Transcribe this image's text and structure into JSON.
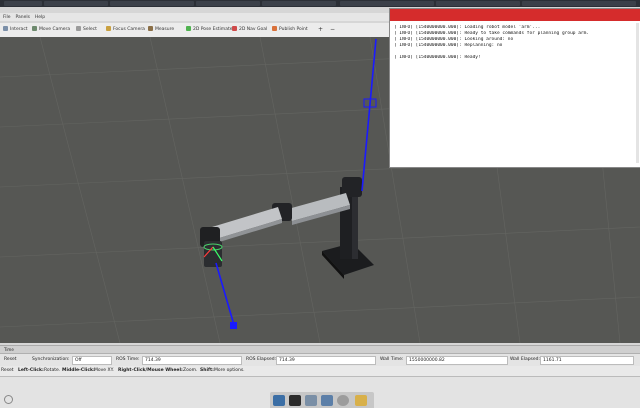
{
  "menubar": {
    "items": [
      "File",
      "Panels",
      "Help"
    ]
  },
  "toolbar": {
    "tools": [
      {
        "label": "Interact",
        "icon": "hand-icon"
      },
      {
        "label": "Move Camera",
        "icon": "camera-icon"
      },
      {
        "label": "Select",
        "icon": "select-icon"
      },
      {
        "label": "Focus Camera",
        "icon": "focus-icon"
      },
      {
        "label": "Measure",
        "icon": "measure-icon"
      },
      {
        "label": "2D Pose Estimate",
        "icon": "pose-icon"
      },
      {
        "label": "2D Nav Goal",
        "icon": "goal-icon"
      },
      {
        "label": "Publish Point",
        "icon": "point-icon"
      }
    ]
  },
  "console": {
    "lines": [
      "[ INFO] [1540000000.000]: Loading robot model 'arm'...",
      "[ INFO] [1540000000.000]: Ready to take commands for planning group arm.",
      "[ INFO] [1540000000.000]: Looking around: no",
      "[ INFO] [1540000000.000]: Replanning: no",
      "",
      "[ INFO] [1540000000.000]: Ready!"
    ]
  },
  "panel_title": "Time",
  "timebar": {
    "reset_label": "Reset",
    "sync_label": "Synchronization:",
    "sync_value": "Off",
    "ros_time_label": "ROS Time:",
    "ros_time": "714.39",
    "ros_elapsed_label": "ROS Elapsed:",
    "ros_elapsed": "714.39",
    "wall_time_label": "Wall Time:",
    "wall_time": "1550000000.82",
    "wall_elapsed_label": "Wall Elapsed:",
    "wall_elapsed": "1161.71"
  },
  "hints": {
    "reset": "Reset",
    "left_click": "Left-Click:",
    "left_action": "Rotate.",
    "middle_click": "Middle-Click:",
    "middle_action": "Move XY.",
    "right_click": "Right-Click/Mouse Wheel:",
    "right_action": "Zoom.",
    "shift": "Shift:",
    "shift_action": "More options."
  },
  "colors": {
    "viewport_bg": "#565754",
    "accent_red": "#d52c2c",
    "axis_blue": "#1a1aff"
  }
}
